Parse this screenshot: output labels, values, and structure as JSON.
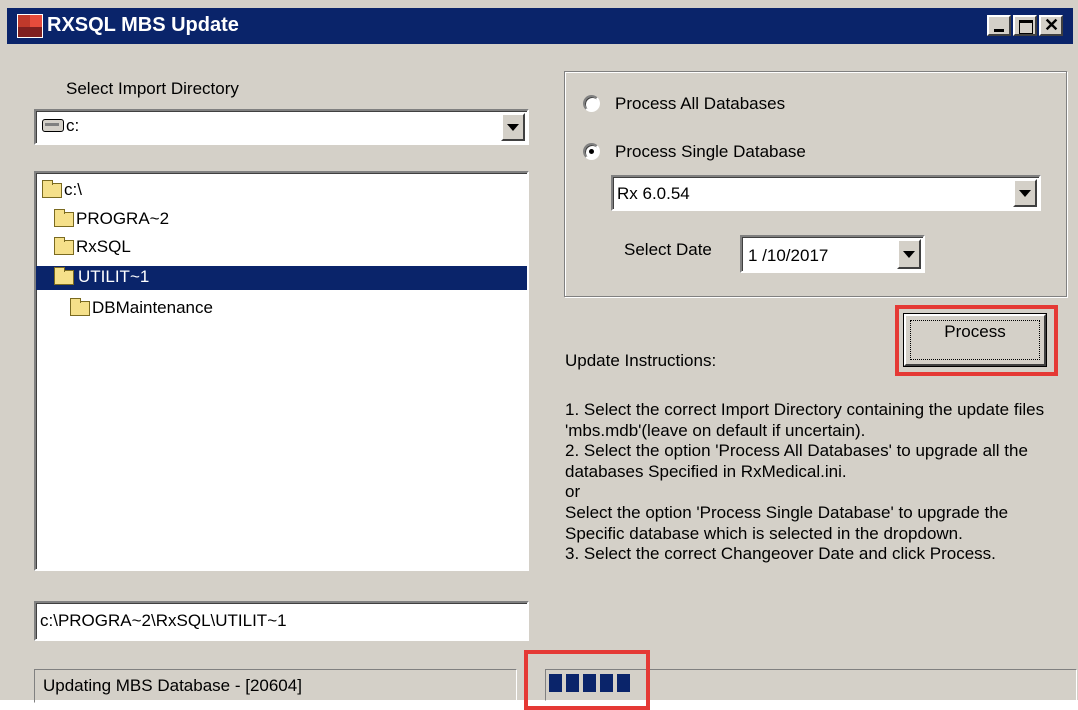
{
  "window": {
    "title": "RXSQL MBS Update",
    "icon": "rx-app-icon",
    "controls": {
      "minimize": "minimize-icon",
      "maximize": "maximize-icon",
      "close": "close-icon"
    }
  },
  "import": {
    "label": "Select Import Directory",
    "drive_value": "c:",
    "tree": [
      {
        "label": "c:\\",
        "selected": false,
        "open": true
      },
      {
        "label": "PROGRA~2",
        "selected": false,
        "open": true
      },
      {
        "label": "RxSQL",
        "selected": false,
        "open": true
      },
      {
        "label": "UTILIT~1",
        "selected": true,
        "open": true
      },
      {
        "label": "DBMaintenance",
        "selected": false,
        "open": false
      }
    ],
    "path_value": "c:\\PROGRA~2\\RxSQL\\UTILIT~1"
  },
  "options": {
    "process_all_label": "Process All Databases",
    "process_single_label": "Process Single Database",
    "selected_option": "single",
    "database_value": "Rx 6.0.54",
    "select_date_label": "Select Date",
    "date_value": "1 /10/2017"
  },
  "process_button": {
    "label": "Process"
  },
  "instructions": {
    "heading": "Update Instructions:",
    "body": "1. Select the correct Import Directory containing the update files 'mbs.mdb'(leave on default if uncertain).\n2. Select the option 'Process All Databases' to upgrade all the databases Specified in RxMedical.ini.\nor\nSelect the option 'Process Single Database' to upgrade the Specific database which is selected in the dropdown.\n3. Select the correct Changeover Date and click Process."
  },
  "status": {
    "text": "Updating MBS Database - [20604]",
    "progress_blocks": 5
  },
  "colors": {
    "title_bar": "#0a246a",
    "face": "#d4d0c8",
    "selection": "#0a246a",
    "highlight_box": "#e53935"
  }
}
